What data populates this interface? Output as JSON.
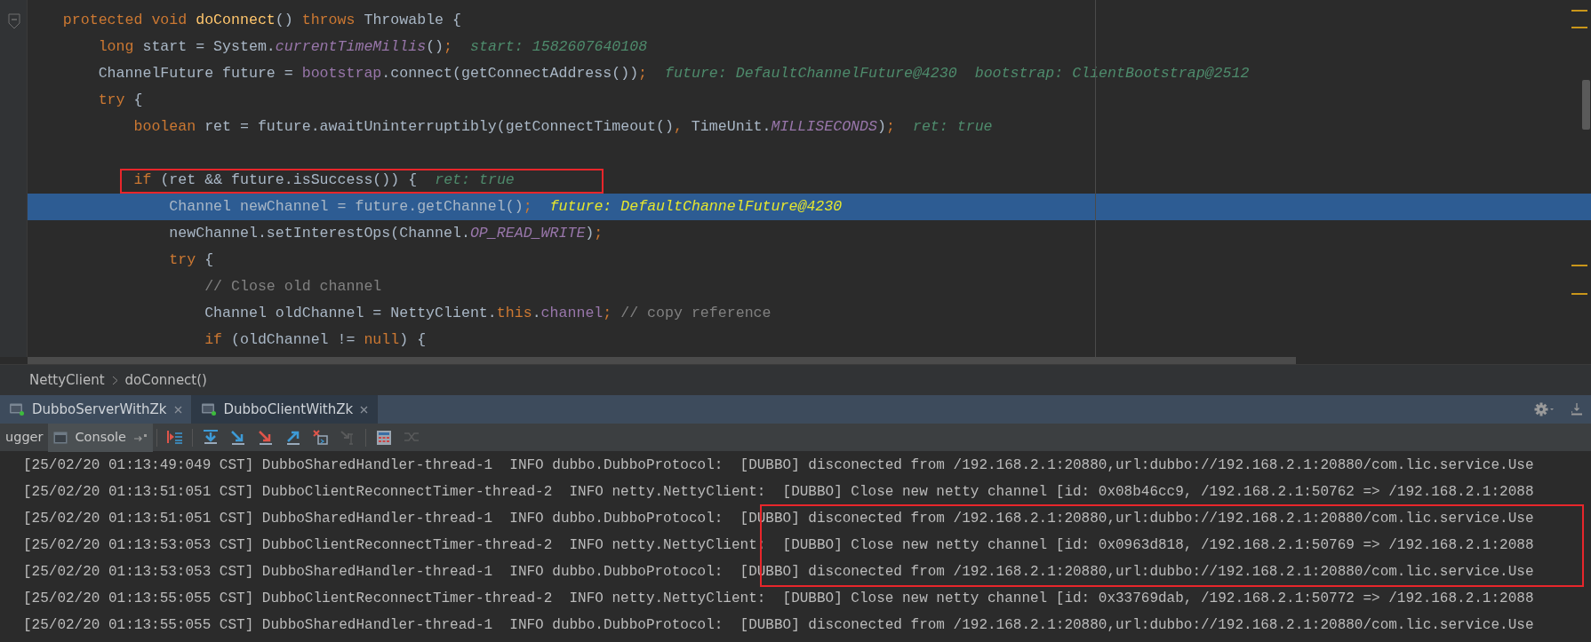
{
  "editor": {
    "lines": [
      {
        "tokens": [
          {
            "t": "    protected void ",
            "kind": "kw"
          },
          {
            "t": "doConnect",
            "kind": "decl"
          },
          {
            "t": "() ",
            "kind": "plain"
          },
          {
            "t": "throws ",
            "kind": "kw"
          },
          {
            "t": "Throwable {",
            "kind": "plain"
          }
        ],
        "selected": false,
        "boxed": false
      },
      {
        "tokens": [
          {
            "t": "        long",
            "kind": "kw"
          },
          {
            "t": " start = System.",
            "kind": "plain"
          },
          {
            "t": "currentTimeMillis",
            "kind": "static"
          },
          {
            "t": "()",
            "kind": "plain"
          },
          {
            "t": ";",
            "kind": "kw"
          }
        ],
        "hints": [
          "start: 1582607640108"
        ],
        "selected": false,
        "boxed": false
      },
      {
        "tokens": [
          {
            "t": "        ChannelFuture future = ",
            "kind": "plain"
          },
          {
            "t": "bootstrap",
            "kind": "field"
          },
          {
            "t": ".connect(getConnectAddress())",
            "kind": "plain"
          },
          {
            "t": ";",
            "kind": "kw"
          }
        ],
        "hints": [
          "future: DefaultChannelFuture@4230",
          "bootstrap: ClientBootstrap@2512"
        ],
        "selected": false,
        "boxed": false
      },
      {
        "tokens": [
          {
            "t": "        try",
            "kind": "kw"
          },
          {
            "t": " {",
            "kind": "plain"
          }
        ],
        "selected": false,
        "boxed": false
      },
      {
        "tokens": [
          {
            "t": "            boolean",
            "kind": "kw"
          },
          {
            "t": " ret = future.awaitUninterruptibly(getConnectTimeout()",
            "kind": "plain"
          },
          {
            "t": ",",
            "kind": "kw"
          },
          {
            "t": " TimeUnit.",
            "kind": "plain"
          },
          {
            "t": "MILLISECONDS",
            "kind": "static"
          },
          {
            "t": ")",
            "kind": "plain"
          },
          {
            "t": ";",
            "kind": "kw"
          }
        ],
        "hints": [
          "ret: true"
        ],
        "selected": false,
        "boxed": false
      },
      {
        "selected": false,
        "boxed": false
      },
      {
        "tokens": [
          {
            "t": "            if",
            "kind": "kw"
          },
          {
            "t": " (ret && future.isSuccess()) {",
            "kind": "plain"
          }
        ],
        "hints": [
          "ret: true"
        ],
        "selected": false,
        "boxed": true
      },
      {
        "tokens": [
          {
            "t": "                Channel newChannel = future.getChannel()",
            "kind": "plain"
          },
          {
            "t": ";",
            "kind": "kw"
          }
        ],
        "hints": [
          "future: DefaultChannelFuture@4230"
        ],
        "selected": true,
        "boxed": false
      },
      {
        "tokens": [
          {
            "t": "                newChannel.setInterestOps(Channel.",
            "kind": "plain"
          },
          {
            "t": "OP_READ_WRITE",
            "kind": "static"
          },
          {
            "t": ")",
            "kind": "plain"
          },
          {
            "t": ";",
            "kind": "kw"
          }
        ],
        "selected": false,
        "boxed": false
      },
      {
        "tokens": [
          {
            "t": "                try",
            "kind": "kw"
          },
          {
            "t": " {",
            "kind": "plain"
          }
        ],
        "selected": false,
        "boxed": false
      },
      {
        "tokens": [
          {
            "t": "                    // Close old channel",
            "kind": "comment"
          }
        ],
        "selected": false,
        "boxed": false
      },
      {
        "tokens": [
          {
            "t": "                    Channel oldChannel = NettyClient.",
            "kind": "plain"
          },
          {
            "t": "this",
            "kind": "kw"
          },
          {
            "t": ".",
            "kind": "plain"
          },
          {
            "t": "channel",
            "kind": "field"
          },
          {
            "t": ";",
            "kind": "kw"
          },
          {
            "t": " // copy reference",
            "kind": "comment"
          }
        ],
        "selected": false,
        "boxed": false
      },
      {
        "tokens": [
          {
            "t": "                    if",
            "kind": "kw"
          },
          {
            "t": " (oldChannel != ",
            "kind": "plain"
          },
          {
            "t": "null",
            "kind": "kw"
          },
          {
            "t": ") {",
            "kind": "plain"
          }
        ],
        "selected": false,
        "boxed": false
      }
    ]
  },
  "breadcrumb": [
    "NettyClient",
    "doConnect()"
  ],
  "run_tabs": [
    {
      "label": "DubboServerWithZk",
      "selected": false
    },
    {
      "label": "DubboClientWithZk",
      "selected": true
    }
  ],
  "debug_tabs": [
    {
      "label": "ugger",
      "selected": false
    },
    {
      "label": "Console",
      "selected": true
    }
  ],
  "toolbar": [
    {
      "kind": "restore",
      "disabled": false
    },
    {
      "kind": "step-over",
      "disabled": false
    },
    {
      "kind": "step-into",
      "disabled": false
    },
    {
      "kind": "force-step-into",
      "disabled": false
    },
    {
      "kind": "step-out",
      "disabled": false
    },
    {
      "kind": "drop-frame",
      "disabled": false
    },
    {
      "kind": "run-to-cursor",
      "disabled": true
    },
    {
      "kind": "evaluate",
      "disabled": false
    },
    {
      "kind": "trace",
      "disabled": true
    }
  ],
  "console": {
    "lines": [
      {
        "text": "[25/02/20 01:13:49:049 CST] DubboSharedHandler-thread-1  INFO dubbo.DubboProtocol:  [DUBBO] disconected from /192.168.2.1:20880,url:dubbo://192.168.2.1:20880/com.lic.service.Use",
        "boxed": false
      },
      {
        "text": "[25/02/20 01:13:51:051 CST] DubboClientReconnectTimer-thread-2  INFO netty.NettyClient:  [DUBBO] Close new netty channel [id: 0x08b46cc9, /192.168.2.1:50762 => /192.168.2.1:2088",
        "boxed": false
      },
      {
        "text": "[25/02/20 01:13:51:051 CST] DubboSharedHandler-thread-1  INFO dubbo.DubboProtocol:  [DUBBO] disconected from /192.168.2.1:20880,url:dubbo://192.168.2.1:20880/com.lic.service.Use",
        "boxed": true
      },
      {
        "text": "[25/02/20 01:13:53:053 CST] DubboClientReconnectTimer-thread-2  INFO netty.NettyClient:  [DUBBO] Close new netty channel [id: 0x0963d818, /192.168.2.1:50769 => /192.168.2.1:2088",
        "boxed": true
      },
      {
        "text": "[25/02/20 01:13:53:053 CST] DubboSharedHandler-thread-1  INFO dubbo.DubboProtocol:  [DUBBO] disconected from /192.168.2.1:20880,url:dubbo://192.168.2.1:20880/com.lic.service.Use",
        "boxed": true
      },
      {
        "text": "[25/02/20 01:13:55:055 CST] DubboClientReconnectTimer-thread-2  INFO netty.NettyClient:  [DUBBO] Close new netty channel [id: 0x33769dab, /192.168.2.1:50772 => /192.168.2.1:2088",
        "boxed": false
      },
      {
        "text": "[25/02/20 01:13:55:055 CST] DubboSharedHandler-thread-1  INFO dubbo.DubboProtocol:  [DUBBO] disconected from /192.168.2.1:20880,url:dubbo://192.168.2.1:20880/com.lic.service.Use",
        "boxed": false
      }
    ]
  }
}
